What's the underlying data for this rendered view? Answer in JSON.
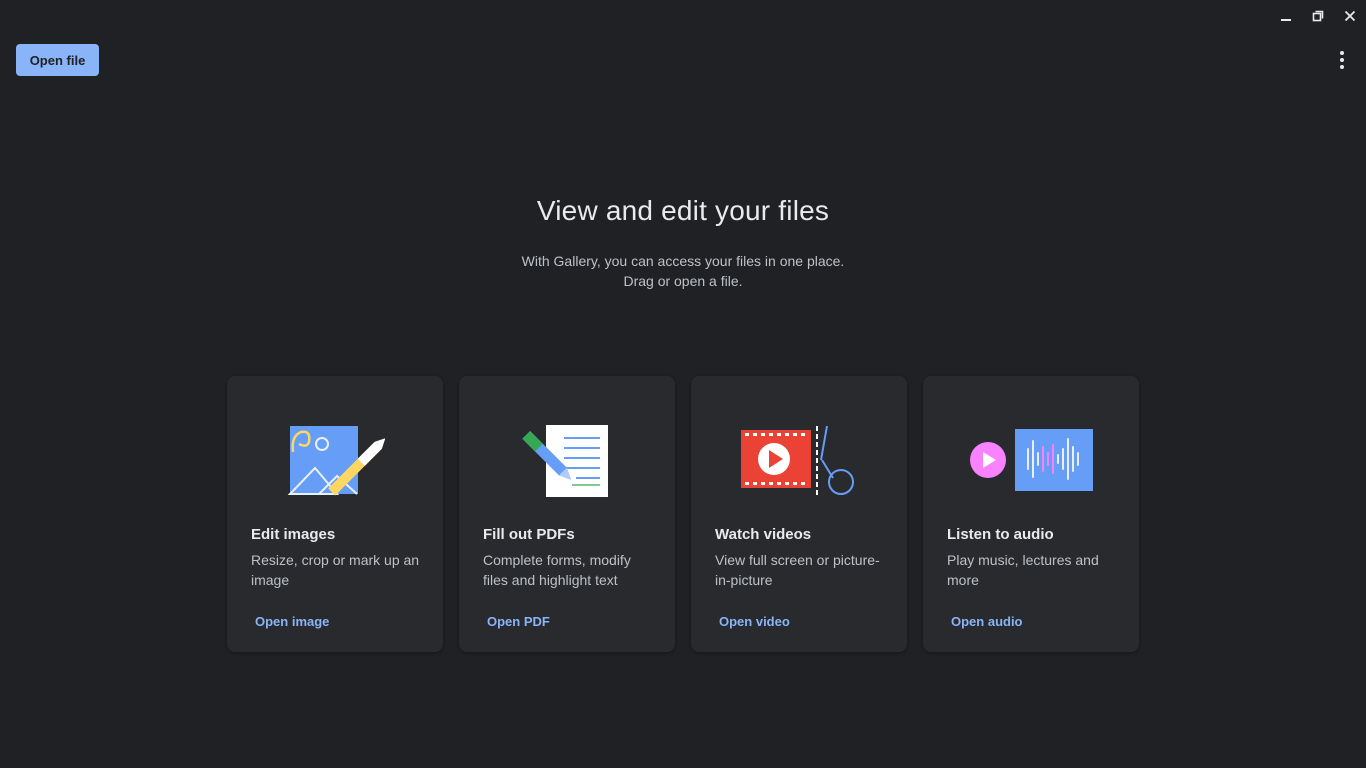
{
  "window": {
    "minimize_icon": "minimize-icon",
    "maximize_icon": "restore-icon",
    "close_icon": "close-icon"
  },
  "toolbar": {
    "open_file_label": "Open file",
    "menu_icon": "more-vert-icon"
  },
  "hero": {
    "title": "View and edit your files",
    "subtitle_line1": "With Gallery, you can access your files in one place.",
    "subtitle_line2": "Drag or open a file."
  },
  "cards": [
    {
      "title": "Edit images",
      "description": "Resize, crop or mark up an image",
      "link": "Open image",
      "icon": "image-edit-icon"
    },
    {
      "title": "Fill out PDFs",
      "description": "Complete forms, modify files and highlight text",
      "link": "Open PDF",
      "icon": "pdf-edit-icon"
    },
    {
      "title": "Watch videos",
      "description": "View full screen or picture-in-picture",
      "link": "Open video",
      "icon": "video-icon"
    },
    {
      "title": "Listen to audio",
      "description": "Play music, lectures and more",
      "link": "Open audio",
      "icon": "audio-icon"
    }
  ],
  "colors": {
    "background": "#202124",
    "card": "#292a2d",
    "accent": "#8ab4f8"
  }
}
